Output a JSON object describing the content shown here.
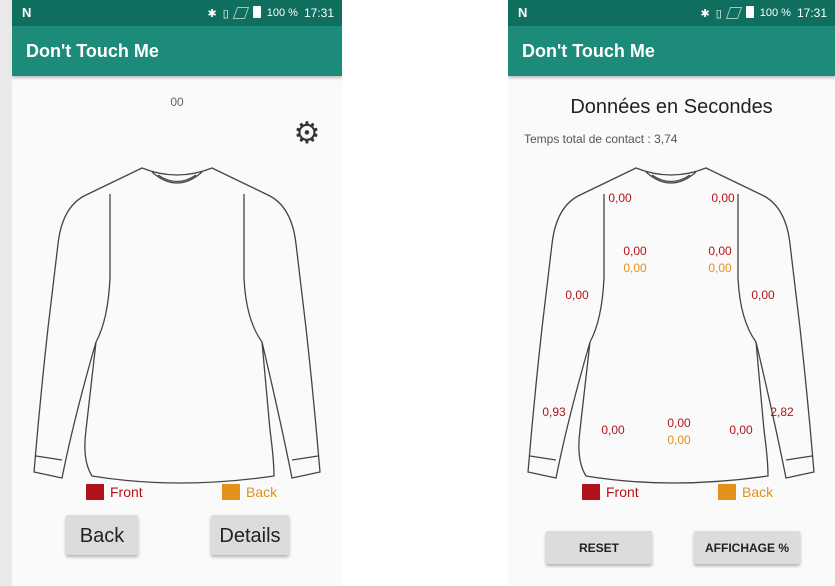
{
  "status_bar": {
    "time": "17:31",
    "battery": "100 %"
  },
  "left_screen": {
    "app_title": "Don't Touch Me",
    "counter": "00",
    "legend": {
      "front": "Front",
      "back": "Back"
    },
    "buttons": {
      "back": "Back",
      "details": "Details"
    }
  },
  "right_screen": {
    "app_title": "Don't Touch Me",
    "heading": "Données en Secondes",
    "total_contact": "Temps total de contact : 3,74",
    "zones": {
      "collar_left": "0,00",
      "collar_right": "0,00",
      "chest_left_front": "0,00",
      "chest_left_back": "0,00",
      "chest_right_front": "0,00",
      "chest_right_back": "0,00",
      "arm_left": "0,00",
      "arm_right": "0,00",
      "forearm_left": "0,93",
      "forearm_right": "2,82",
      "waist_left": "0,00",
      "waist_center_front": "0,00",
      "waist_center_back": "0,00",
      "waist_right": "0,00"
    },
    "legend": {
      "front": "Front",
      "back": "Back"
    },
    "buttons": {
      "reset": "RESET",
      "display_percent": "AFFICHAGE %"
    }
  },
  "colors": {
    "status_bar": "#0f6e5e",
    "app_bar": "#1d8b79",
    "front": "#b0141a",
    "back": "#e5901a"
  },
  "icons": {
    "settings": "gear-icon"
  }
}
